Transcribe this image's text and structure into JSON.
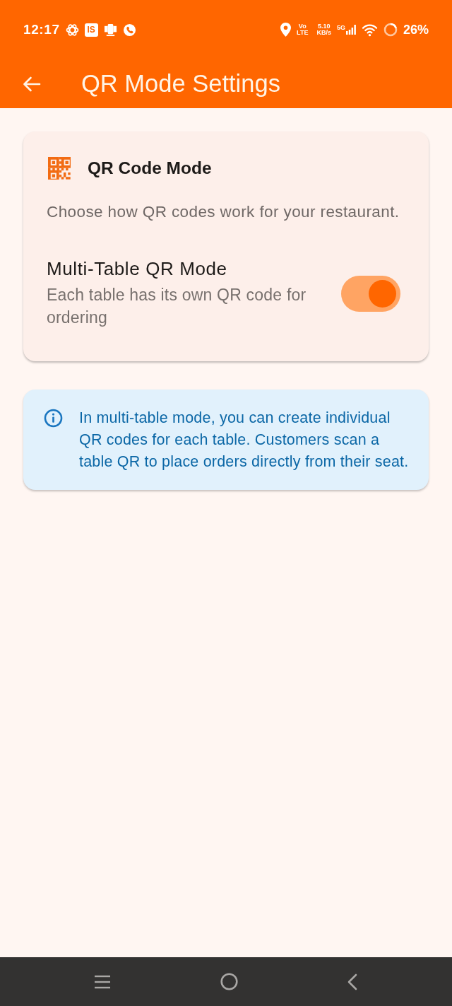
{
  "status_bar": {
    "time": "12:17",
    "app_badge": "IS",
    "volte": [
      "Vo",
      "LTE"
    ],
    "speed": [
      "5.10",
      "KB/s"
    ],
    "network": "5G",
    "battery": "26%"
  },
  "app_bar": {
    "title": "QR Mode Settings"
  },
  "mode_card": {
    "title": "QR Code Mode",
    "description": "Choose how QR codes work for your restaurant.",
    "setting": {
      "title": "Multi-Table QR Mode",
      "subtitle": "Each table has its own QR code for ordering",
      "on": true
    }
  },
  "info_card": {
    "text": "In multi-table mode, you can create individual QR codes for each table. Customers scan a table QR to place orders directly from their seat."
  }
}
